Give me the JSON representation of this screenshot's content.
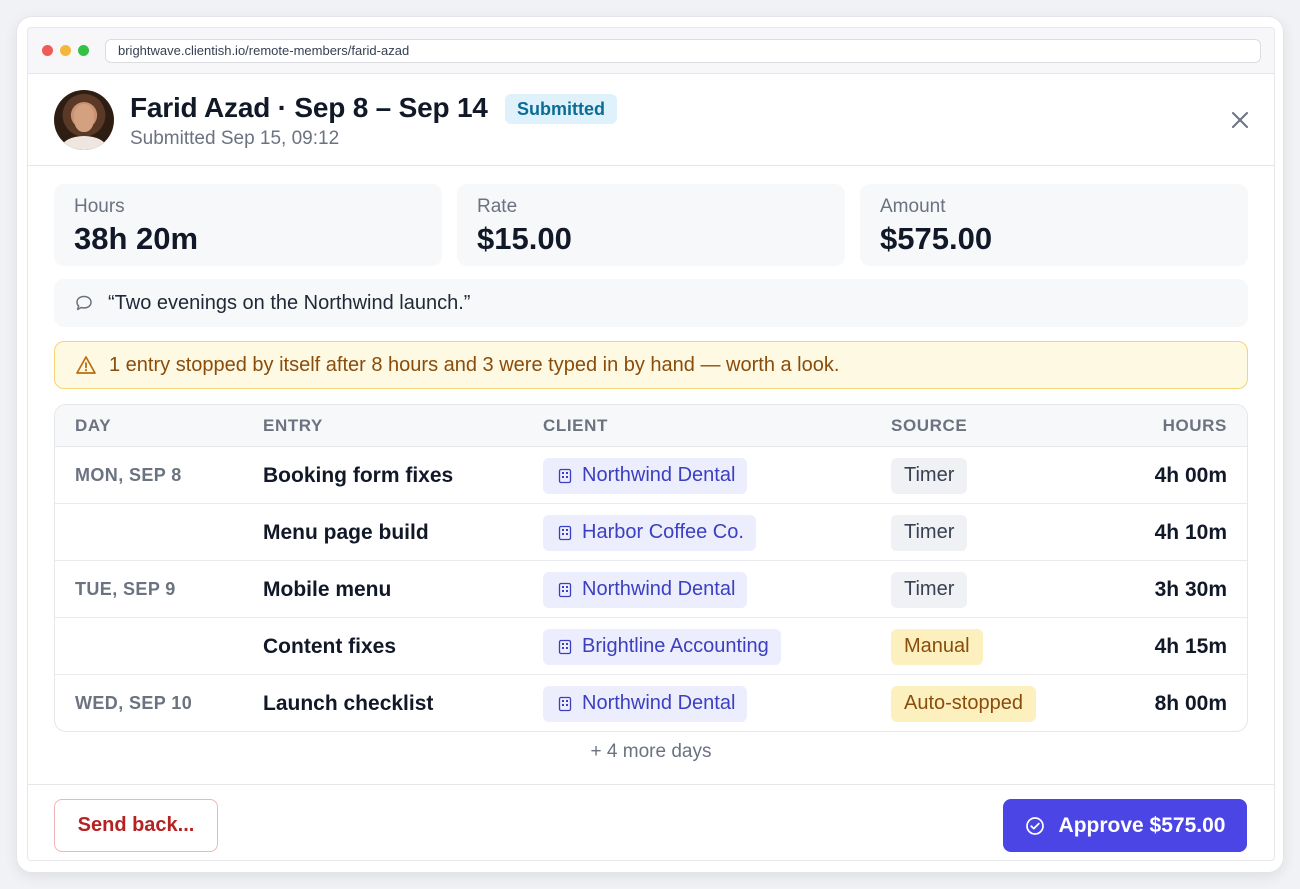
{
  "browser": {
    "url": "brightwave.clientish.io/remote-members/farid-azad"
  },
  "header": {
    "title": "Farid Azad · Sep 8 – Sep 14",
    "status_badge": "Submitted",
    "subtitle": "Submitted Sep 15, 09:12",
    "close_icon": "close-icon"
  },
  "stats": [
    {
      "label": "Hours",
      "value": "38h 20m"
    },
    {
      "label": "Rate",
      "value": "$15.00"
    },
    {
      "label": "Amount",
      "value": "$575.00"
    }
  ],
  "note": {
    "icon": "comment-icon",
    "text": "“Two evenings on the Northwind launch.”"
  },
  "warning": {
    "icon": "warning-triangle-icon",
    "text": "1 entry stopped by itself after 8 hours and 3 were typed in by hand — worth a look."
  },
  "table": {
    "columns": {
      "day": "DAY",
      "entry": "ENTRY",
      "client": "CLIENT",
      "source": "SOURCE",
      "hours": "HOURS"
    },
    "rows": [
      {
        "day": "MON, SEP 8",
        "entry": "Booking form fixes",
        "client": "Northwind Dental",
        "source": "Timer",
        "hours": "4h 00m"
      },
      {
        "day": "",
        "entry": "Menu page build",
        "client": "Harbor Coffee Co.",
        "source": "Timer",
        "hours": "4h 10m"
      },
      {
        "day": "TUE, SEP 9",
        "entry": "Mobile menu",
        "client": "Northwind Dental",
        "source": "Timer",
        "hours": "3h 30m"
      },
      {
        "day": "",
        "entry": "Content fixes",
        "client": "Brightline Accounting",
        "source": "Manual",
        "hours": "4h 15m"
      },
      {
        "day": "WED, SEP 10",
        "entry": "Launch checklist",
        "client": "Northwind Dental",
        "source": "Auto-stopped",
        "hours": "8h 00m"
      }
    ],
    "more_label": "+ 4 more days"
  },
  "footer": {
    "send_back_label": "Send back...",
    "approve_label": "Approve $575.00"
  },
  "colors": {
    "accent": "#4b45e6",
    "submitted_badge_bg": "#dff1fb",
    "warning_bg": "#fef9e3",
    "client_pill_bg": "#eceefd",
    "danger": "#b42323"
  }
}
